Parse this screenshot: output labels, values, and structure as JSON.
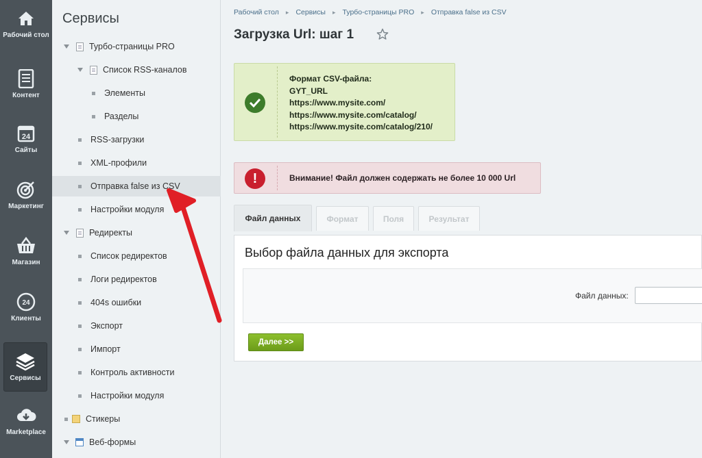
{
  "rail": [
    {
      "label": "Рабочий стол",
      "icon": "home-icon"
    },
    {
      "label": "Контент",
      "icon": "document-icon"
    },
    {
      "label": "Сайты",
      "icon": "calendar-24-icon",
      "badge": "24"
    },
    {
      "label": "Маркетинг",
      "icon": "target-icon"
    },
    {
      "label": "Магазин",
      "icon": "basket-icon"
    },
    {
      "label": "Клиенты",
      "icon": "clients-24-icon",
      "badge": "24"
    },
    {
      "label": "Сервисы",
      "icon": "layers-icon",
      "active": true
    },
    {
      "label": "Marketplace",
      "icon": "cloud-download-icon"
    }
  ],
  "menu": {
    "title": "Сервисы",
    "items": [
      {
        "label": "Турбо-страницы PRO"
      },
      {
        "label": "Список RSS-каналов"
      },
      {
        "label": "Элементы"
      },
      {
        "label": "Разделы"
      },
      {
        "label": "RSS-загрузки"
      },
      {
        "label": "XML-профили"
      },
      {
        "label": "Отправка false из CSV"
      },
      {
        "label": "Настройки модуля"
      },
      {
        "label": "Редиректы"
      },
      {
        "label": "Список редиректов"
      },
      {
        "label": "Логи редиректов"
      },
      {
        "label": "404s ошибки"
      },
      {
        "label": "Экспорт"
      },
      {
        "label": "Импорт"
      },
      {
        "label": "Контроль активности"
      },
      {
        "label": "Настройки модуля"
      },
      {
        "label": "Стикеры"
      },
      {
        "label": "Веб-формы"
      }
    ]
  },
  "breadcrumbs": [
    "Рабочий стол",
    "Сервисы",
    "Турбо-страницы PRO",
    "Отправка false из CSV"
  ],
  "page": {
    "title": "Загрузка Url: шаг 1"
  },
  "notes": {
    "ok_lines": [
      "Формат CSV-файла:",
      "GYT_URL",
      "https://www.mysite.com/",
      "https://www.mysite.com/catalog/",
      "https://www.mysite.com/catalog/210/"
    ],
    "error_text": "Внимание! Файл должен содержать не более 10 000 Url",
    "error_symbol": "!"
  },
  "tabs": [
    "Файл данных",
    "Формат",
    "Поля",
    "Результат"
  ],
  "panel": {
    "title": "Выбор файла данных для экспорта",
    "field_label": "Файл данных:",
    "next_button": "Далее >>"
  },
  "colors": {
    "rail_bg": "#4b5359",
    "success_bg": "#e3efc9",
    "success_icon": "#3d7c2b",
    "error_bg": "#f0dde0",
    "error_icon": "#c91f2e",
    "button_green": "#7aab22",
    "arrow_red": "#e01f26"
  }
}
